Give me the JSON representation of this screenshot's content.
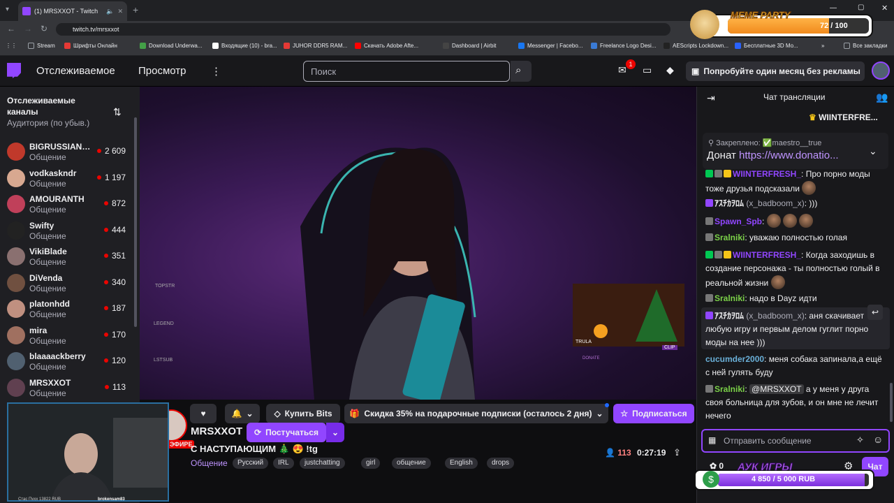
{
  "browser": {
    "tab_title": "(1) MRSXXOT - Twitch",
    "url": "twitch.tv/mrsxxot",
    "bookmarks": [
      "Stream",
      "Шрифты Онлайн",
      "Download Underwa...",
      "Входящие (10) - bra...",
      "JUHOR DDR5 RAM...",
      "Скачать Adobe Afte...",
      "Dashboard | Airbit",
      "Messenger | Facebo...",
      "Freelance Logo Desi...",
      "AEScripts Lockdown...",
      "Бесплатные 3D Mo..."
    ],
    "all_bookmarks": "Все закладки"
  },
  "meme_party": {
    "title": "MEME PARTY",
    "progress": "72 / 100",
    "fraction": 0.72
  },
  "nav": {
    "following": "Отслеживаемое",
    "browse": "Просмотр",
    "search_placeholder": "Поиск",
    "inbox_badge": "1",
    "promo": "Попробуйте один месяц без рекламы"
  },
  "sidebar": {
    "header": "Отслеживаемые каналы",
    "sort": "Аудитория (по убыв.)",
    "channels": [
      {
        "name": "BIGRUSSIANM...",
        "category": "Общение",
        "viewers": "2 609",
        "color": "#c0392b"
      },
      {
        "name": "vodkaskndr",
        "category": "Общение",
        "viewers": "1 197",
        "color": "#d8a890"
      },
      {
        "name": "AMOURANTH",
        "category": "Общение",
        "viewers": "872",
        "color": "#c0405a"
      },
      {
        "name": "Swifty",
        "category": "Общение",
        "viewers": "444",
        "color": "#222"
      },
      {
        "name": "VikiBlade",
        "category": "Общение",
        "viewers": "351",
        "color": "#8a7070"
      },
      {
        "name": "DiVenda",
        "category": "Общение",
        "viewers": "340",
        "color": "#705040"
      },
      {
        "name": "platonhdd",
        "category": "Общение",
        "viewers": "187",
        "color": "#c09080"
      },
      {
        "name": "mira",
        "category": "Общение",
        "viewers": "170",
        "color": "#a07060"
      },
      {
        "name": "blaaaackberry",
        "category": "Общение",
        "viewers": "120",
        "color": "#506070"
      },
      {
        "name": "MRSXXOT",
        "category": "Общение",
        "viewers": "113",
        "color": "#604050"
      }
    ]
  },
  "video": {
    "overlay_labels": [
      "TOPSTR",
      "LEGEND",
      "LSTSUB",
      "TRULA",
      "CLIP",
      "DONATE"
    ]
  },
  "stream": {
    "streamer": "MRSXXOT",
    "live": "ЭФИРЕ",
    "raid_btn": "Постучаться",
    "title": "С НАСТУПАЮЩИМ 🎄 😍 !tg",
    "category": "Общение",
    "tags": [
      "Русский",
      "IRL",
      "justchatting",
      "girl",
      "общение",
      "English",
      "drops"
    ],
    "viewers": "113",
    "uptime": "0:27:19",
    "bits_btn": "Купить Bits",
    "gift_promo": "Скидка 35% на подарочные подписки (осталось 2 дня)",
    "subscribe_btn": "Подписаться"
  },
  "chat": {
    "header": "Чат трансляции",
    "top_gifter": "WIINTERFRE...",
    "pinned_label": "Закреплено:",
    "pinned_user": "maestro__true",
    "pinned_text": "Донат",
    "pinned_link": "https://www.donatio...",
    "messages": [
      {
        "user": "WIINTERFRESH_",
        "color": "#9146ff",
        "text": "Про порно моды тоже друзья подсказали"
      },
      {
        "user": "ｱｽﾁｶｦﾛﾑ",
        "sub": "(x_badboom_x)",
        "color": "#efeff1",
        "text": ")))"
      },
      {
        "user": "Spawn_Spb",
        "color": "#9146ff",
        "text": ""
      },
      {
        "user": "Sralniki",
        "color": "#7bd148",
        "text": "уважаю полностью голая"
      },
      {
        "user": "WIINTERFRESH_",
        "color": "#9146ff",
        "text": "Когда заходишь в создание персонажа - ты полностью голый в реальной жизни"
      },
      {
        "user": "Sralniki",
        "color": "#7bd148",
        "text": "надо в Dayz идти"
      },
      {
        "user": "ｱｽﾁｶｦﾛﾑ",
        "sub": "(x_badboom_x)",
        "color": "#efeff1",
        "text": "аня скачивает любую игру и первым делом гуглит порно моды на нее )))"
      },
      {
        "user": "cucumder2000",
        "color": "#6ab0d8",
        "text": "меня собака запинала,а ещё с ней гулять буду"
      },
      {
        "user": "Sralniki",
        "color": "#7bd148",
        "mention": "@MRSXXOT",
        "text": "а у меня у друга своя больница для зубов, и он мне не лечит нечего"
      }
    ],
    "input_placeholder": "Отправить сообщение",
    "points": "0",
    "chat_btn": "Чат"
  },
  "auction": {
    "title": "АУК ИГРЫ",
    "progress": "4 850 / 5 000 RUB",
    "fraction": 0.97
  },
  "webcam": {
    "donation": "Стас Пухх 13822 RUB",
    "name": "brokensam83"
  }
}
